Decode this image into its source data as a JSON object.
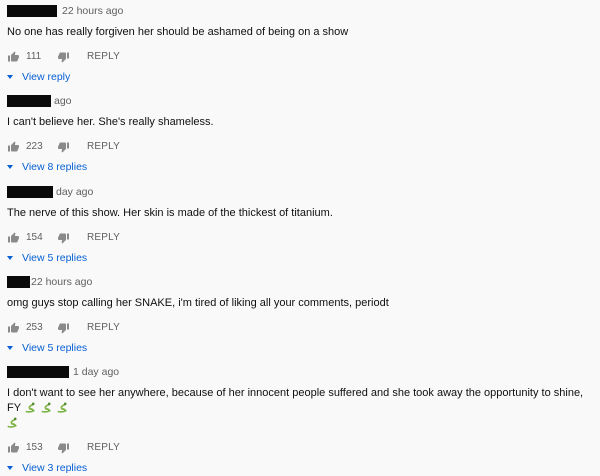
{
  "comments": [
    {
      "time": "22 hours ago",
      "text": "No one has really forgiven her should be ashamed of being on a show",
      "likes": "111",
      "reply": "REPLY",
      "view": "View reply",
      "emoji": []
    },
    {
      "time": "ago",
      "text": "I can't believe her. She's really shameless.",
      "likes": "223",
      "reply": "REPLY",
      "view": "View 8 replies",
      "emoji": []
    },
    {
      "time": "day ago",
      "text": "The nerve of this show.  Her skin is made of the thickest of titanium.",
      "likes": "154",
      "reply": "REPLY",
      "view": "View 5 replies",
      "emoji": []
    },
    {
      "time": "22 hours ago",
      "text": "omg guys stop calling her SNAKE, i'm tired of liking all your comments, periodt",
      "likes": "253",
      "reply": "REPLY",
      "view": "View 5 replies",
      "emoji": []
    },
    {
      "time": "1 day ago",
      "text": "I don't want to see her anywhere, because of her innocent people suffered and she took away the opportunity to shine, FY ",
      "likes": "153",
      "reply": "REPLY",
      "view": "View 3 replies",
      "emoji": [
        "snake-icon",
        "snake-icon",
        "snake-icon",
        "snake-icon"
      ]
    }
  ],
  "colors": {
    "link": "#065fd4",
    "meta": "#606060",
    "text": "#0f0f0f",
    "background": "#f9f9f9",
    "redaction": "#0a0a0a"
  }
}
